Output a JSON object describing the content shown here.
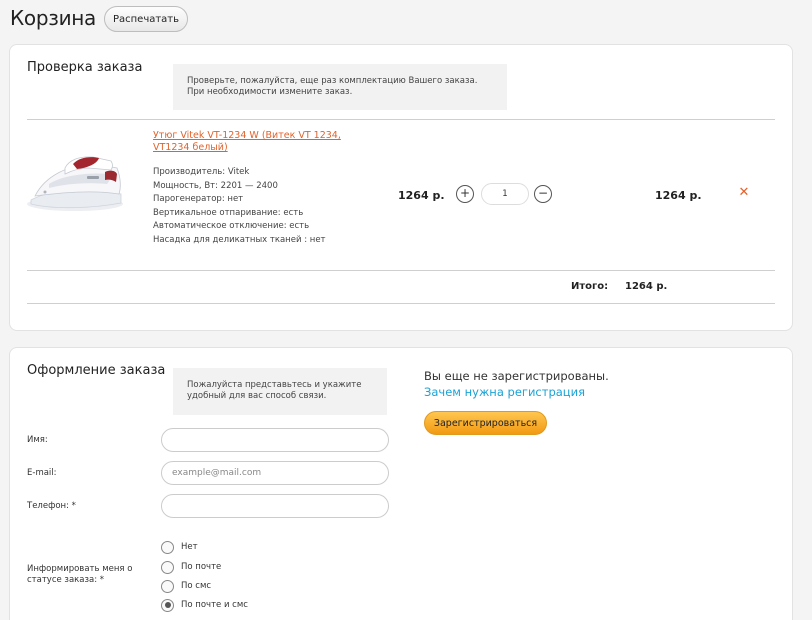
{
  "page": {
    "title": "Корзина",
    "print_label": "Распечатать"
  },
  "check": {
    "title": "Проверка заказа",
    "hint": "Проверьте, пожалуйста, еще раз комплектацию Вашего заказа. При необходимости измените заказ.",
    "product": {
      "name": "Утюг Vitek VT-1234 W (Витек VT 1234, VT1234 белый)",
      "props": [
        "Производитель: Vitek",
        "Мощность, Вт: 2201 — 2400",
        "Парогенератор: нет",
        "Вертикальное отпаривание: есть",
        "Автоматическое отключение: есть",
        "Насадка для деликатных тканей : нет"
      ],
      "price": "1264 р.",
      "plus_label": "+",
      "minus_label": "−",
      "quantity": "1",
      "sum": "1264 р.",
      "remove_label": "✕"
    },
    "total_label": "Итого:",
    "total_value": "1264 р."
  },
  "order": {
    "title": "Оформление заказа",
    "hint": "Пожалуйста представьтесь и укажите удобный для вас способ связи.",
    "fields": {
      "name_label": "Имя:",
      "name_value": "",
      "email_label": "E-mail:",
      "email_placeholder": "example@mail.com",
      "phone_label": "Телефон: *",
      "phone_value": ""
    },
    "notify": {
      "label": "Информировать меня о статусе заказа: *",
      "options": [
        "Нет",
        "По почте",
        "По смс",
        "По почте и смс"
      ],
      "selected": "По почте и смс"
    },
    "register": {
      "text": "Вы еще не зарегистрированы.",
      "link": "Зачем нужна регистрация",
      "button": "Зарегистрироваться"
    }
  },
  "colors": {
    "accent": "#e2622b",
    "link": "#1aa3d6",
    "button_orange": "#f5a623"
  }
}
